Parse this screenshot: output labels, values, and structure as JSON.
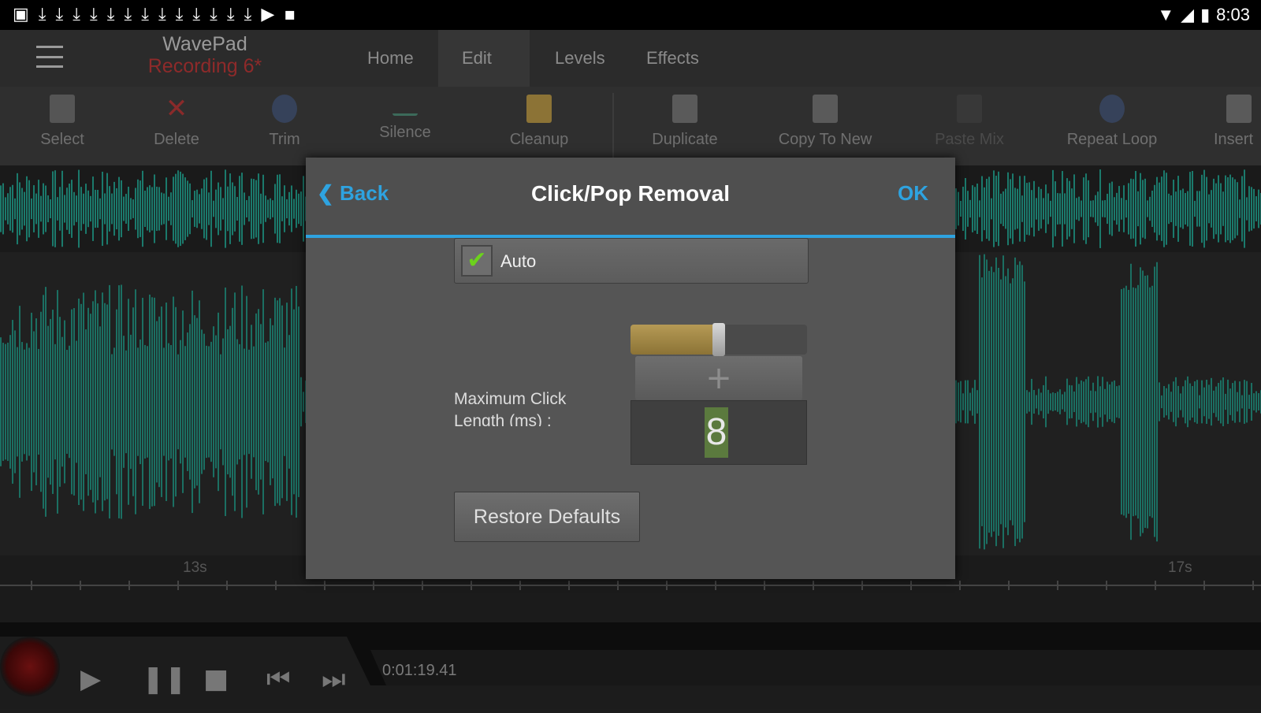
{
  "status_bar": {
    "notification_icons": [
      "image-icon",
      "download-icon",
      "download-icon",
      "download-icon",
      "download-icon",
      "download-icon",
      "download-icon",
      "download-icon",
      "download-icon",
      "download-icon",
      "download-icon",
      "download-icon",
      "download-icon",
      "download-icon",
      "download-icon",
      "play-store-icon",
      "square-icon"
    ],
    "time": "8:03"
  },
  "app_bar": {
    "app_name": "WavePad",
    "file_name": "Recording 6*",
    "tabs": [
      "Home",
      "Edit",
      "Levels",
      "Effects"
    ],
    "active_tab": "Edit"
  },
  "toolbar": {
    "items": [
      {
        "label": "Select",
        "icon": "select-icon"
      },
      {
        "label": "Delete",
        "icon": "delete-icon"
      },
      {
        "label": "Trim",
        "icon": "trim-icon"
      },
      {
        "label": "Silence",
        "icon": "silence-icon"
      },
      {
        "label": "Cleanup",
        "icon": "cleanup-icon"
      },
      {
        "label": "Duplicate",
        "icon": "duplicate-icon"
      },
      {
        "label": "Copy To New",
        "icon": "copy-to-new-icon"
      },
      {
        "label": "Paste Mix",
        "icon": "paste-mix-icon"
      },
      {
        "label": "Repeat Loop",
        "icon": "repeat-loop-icon"
      },
      {
        "label": "Insert",
        "icon": "insert-icon"
      }
    ]
  },
  "timeline": {
    "labels": [
      "13s",
      "17s"
    ]
  },
  "transport": {
    "time": "0:01:19.41"
  },
  "dialog": {
    "back_label": "Back",
    "title": "Click/Pop Removal",
    "ok_label": "OK",
    "auto_label": "Auto",
    "auto_checked": true,
    "param_label": "Maximum Click Length (ms) :",
    "param_value": "8",
    "slider_fraction": 0.5,
    "restore_label": "Restore Defaults",
    "accent_color": "#2ea3e0"
  },
  "colors": {
    "waveform": "#1b7a6c",
    "recording_name": "#8e2a2a",
    "checkmark": "#6cd21c"
  }
}
